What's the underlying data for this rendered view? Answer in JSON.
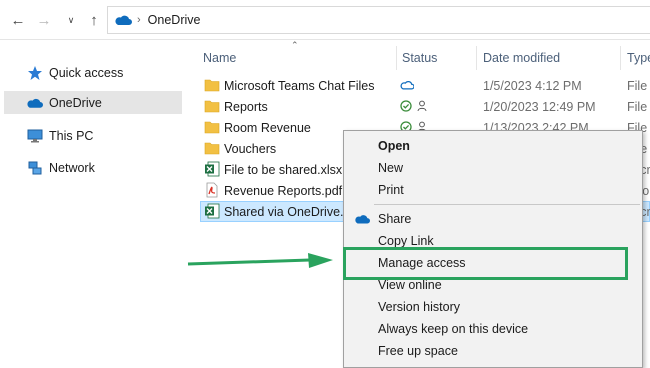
{
  "address_bar": {
    "crumbs": [
      "OneDrive"
    ],
    "icons": [
      "back-arrow",
      "forward-arrow",
      "dropdown-chevron",
      "up-arrow",
      "onedrive-cloud",
      "breadcrumb-separator"
    ]
  },
  "nav_pane": {
    "items": [
      {
        "label": "Quick access",
        "icon": "star-icon",
        "selected": false
      },
      {
        "label": "OneDrive",
        "icon": "cloud-icon",
        "selected": true
      },
      {
        "label": "This PC",
        "icon": "monitor-icon",
        "selected": false
      },
      {
        "label": "Network",
        "icon": "network-icon",
        "selected": false
      }
    ]
  },
  "columns": {
    "name": "Name",
    "status": "Status",
    "date": "Date modified",
    "type": "Type"
  },
  "files": [
    {
      "name": "Microsoft Teams Chat Files",
      "kind": "folder",
      "status": [
        "cloud"
      ],
      "date": "1/5/2023 4:12 PM",
      "type": "File fo"
    },
    {
      "name": "Reports",
      "kind": "folder",
      "status": [
        "check",
        "person"
      ],
      "date": "1/20/2023 12:49 PM",
      "type": "File fo"
    },
    {
      "name": "Room Revenue",
      "kind": "folder",
      "status": [
        "check",
        "person"
      ],
      "date": "1/13/2023 2:42 PM",
      "type": "File fo"
    },
    {
      "name": "Vouchers",
      "kind": "folder",
      "status": [],
      "date": "",
      "type": "File fo"
    },
    {
      "name": "File to be shared.xlsx",
      "kind": "excel",
      "status": [],
      "date": "",
      "type": "Micr"
    },
    {
      "name": "Revenue Reports.pdf",
      "kind": "pdf",
      "status": [],
      "date": "",
      "type": "Ado"
    },
    {
      "name": "Shared via OneDrive.xl",
      "kind": "excel",
      "status": [],
      "date": "",
      "type": "Micr",
      "selected": true
    }
  ],
  "context_menu": {
    "items": [
      {
        "label": "Open",
        "bold": true
      },
      {
        "label": "New"
      },
      {
        "label": "Print"
      },
      {
        "label": "Share",
        "icon": "onedrive-cloud-icon"
      },
      {
        "label": "Copy Link"
      },
      {
        "label": "Manage access"
      },
      {
        "label": "View online"
      },
      {
        "label": "Version history"
      },
      {
        "label": "Always keep on this device"
      },
      {
        "label": "Free up space"
      }
    ]
  },
  "annotation": {
    "color": "#2aa35e",
    "target": "Manage access"
  },
  "colors": {
    "selection": "#cce8ff",
    "folder": "#f2c043",
    "excel": "#1d6f42",
    "pdf": "#d93025",
    "onedrive": "#0f6cbd",
    "status_green": "#3a8c3a"
  }
}
